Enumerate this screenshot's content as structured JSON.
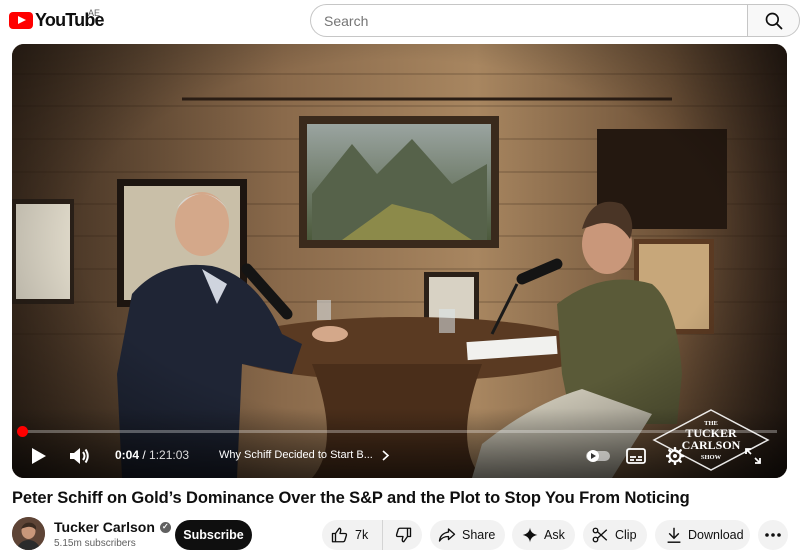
{
  "header": {
    "logo_text": "YouTube",
    "country_code": "AE",
    "search_placeholder": "Search"
  },
  "player": {
    "progress_fraction": 0.008,
    "current_time": "0:04",
    "duration": "1:21:03",
    "time_separator": " / ",
    "chapter_title": "Why Schiff Decided to Start B...",
    "watermark_lines": [
      "THE",
      "TUCKER",
      "CARLSON",
      "SHOW"
    ]
  },
  "video": {
    "title": "Peter Schiff on Gold’s Dominance Over the S&P and the Plot to Stop You From Noticing"
  },
  "channel": {
    "name": "Tucker Carlson",
    "subscribers": "5.15m subscribers",
    "subscribe_label": "Subscribe"
  },
  "actions": {
    "like_count": "7k",
    "share_label": "Share",
    "ask_label": "Ask",
    "clip_label": "Clip",
    "download_label": "Download"
  },
  "colors": {
    "brand_red": "#ff0000",
    "text_primary": "#0f0f0f",
    "text_secondary": "#606060",
    "pill_bg": "#f2f2f2"
  }
}
